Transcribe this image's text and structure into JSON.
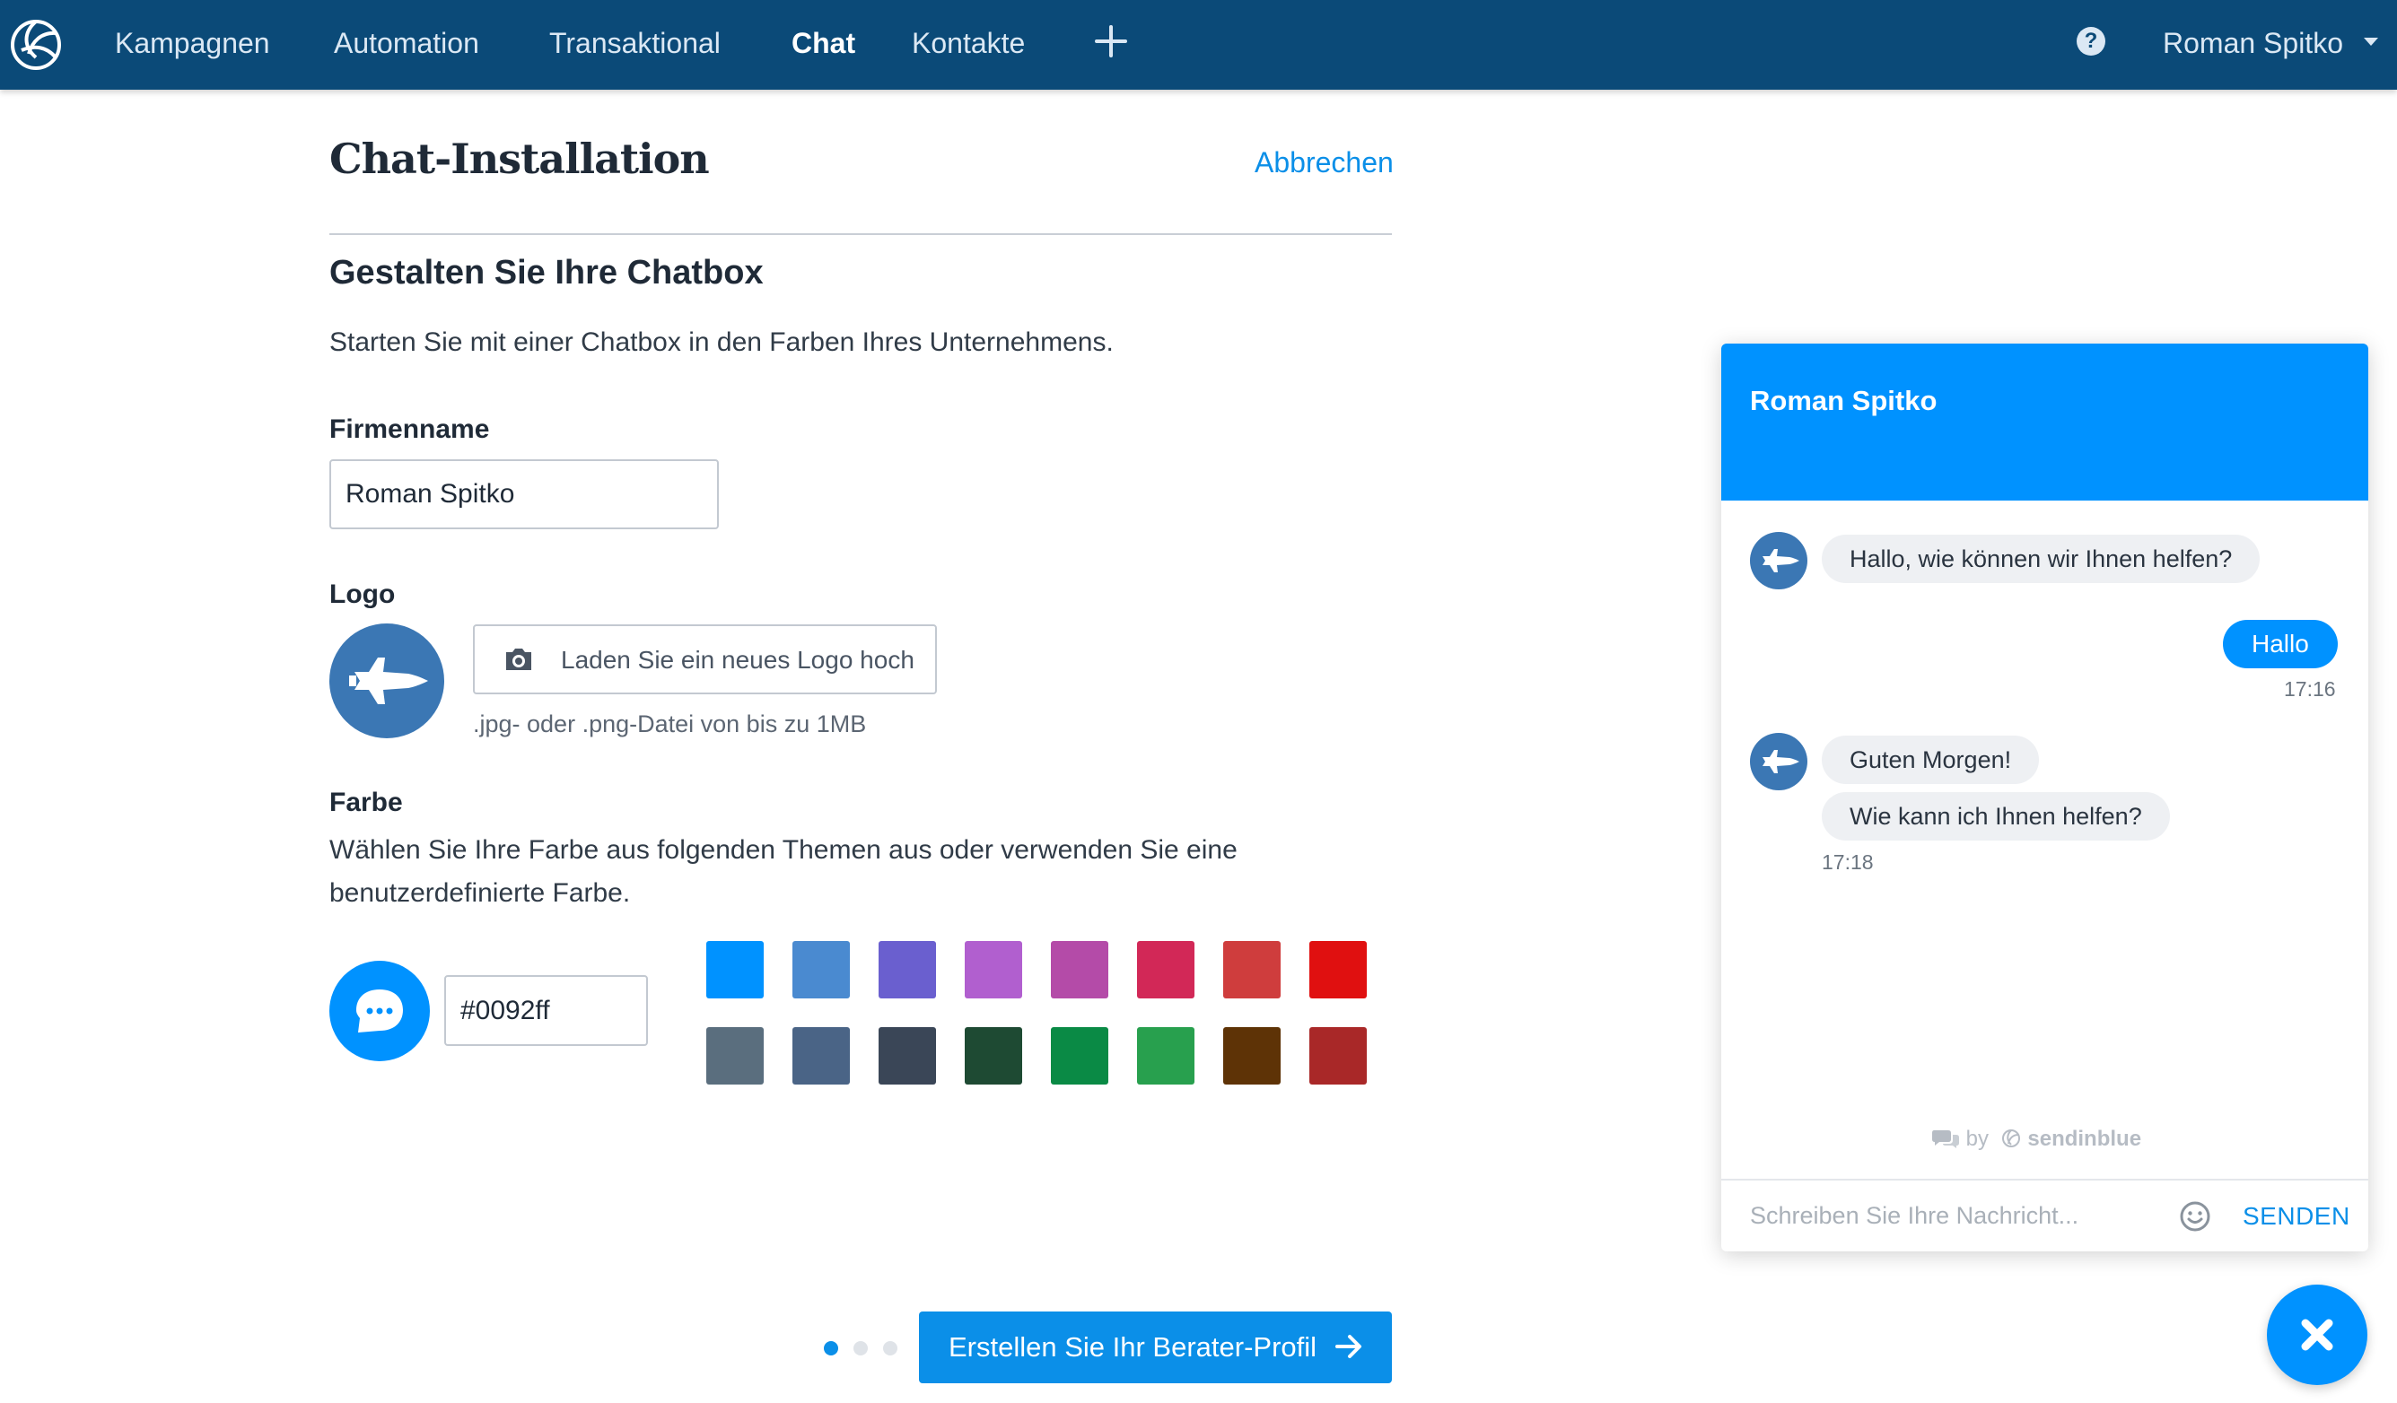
{
  "nav": {
    "items": [
      {
        "label": "Kampagnen",
        "active": false
      },
      {
        "label": "Automation",
        "active": false
      },
      {
        "label": "Transaktional",
        "active": false
      },
      {
        "label": "Chat",
        "active": true
      },
      {
        "label": "Kontakte",
        "active": false
      }
    ],
    "help_glyph": "?",
    "user_name": "Roman Spitko",
    "bar_color": "#0b4a78"
  },
  "form": {
    "title": "Chat-Installation",
    "cancel_label": "Abbrechen",
    "section_title": "Gestalten Sie Ihre Chatbox",
    "section_desc": "Starten Sie mit einer Chatbox in den Farben Ihres Unternehmens.",
    "company_label": "Firmenname",
    "company_value": "Roman Spitko",
    "logo_label": "Logo",
    "upload_label": "Laden Sie ein neues Logo hoch",
    "upload_hint": ".jpg- oder .png-Datei von bis zu 1MB",
    "color_label": "Farbe",
    "color_desc": "Wählen Sie Ihre Farbe aus folgenden Themen aus oder verwenden Sie eine benutzerdefinierte Farbe.",
    "color_value": "#0092ff",
    "swatches_row1": [
      "#0092ff",
      "#4a8ad0",
      "#6a5fcf",
      "#b15fcf",
      "#b44ba8",
      "#d22857",
      "#cf3d3d",
      "#e01010"
    ],
    "swatches_row2": [
      "#5a6e7e",
      "#4a6486",
      "#3a4657",
      "#1e4a33",
      "#0a8a45",
      "#28a04e",
      "#5e3306",
      "#a92828"
    ],
    "next_label": "Erstellen Sie Ihr Berater-Profil",
    "steps_total": 3,
    "steps_current": 1
  },
  "chat": {
    "header_title": "Roman Spitko",
    "messages": [
      {
        "from": "agent",
        "text": "Hallo, wie können wir Ihnen helfen?"
      },
      {
        "from": "visitor",
        "text": "Hallo",
        "time": "17:16"
      },
      {
        "from": "agent",
        "text": "Guten Morgen!"
      },
      {
        "from": "agent",
        "text": "Wie kann ich Ihnen helfen?",
        "time": "17:18"
      }
    ],
    "powered_by": "by",
    "powered_brand": "sendinblue",
    "input_placeholder": "Schreiben Sie Ihre Nachricht...",
    "send_label": "SENDEN",
    "accent_color": "#0092ff"
  }
}
